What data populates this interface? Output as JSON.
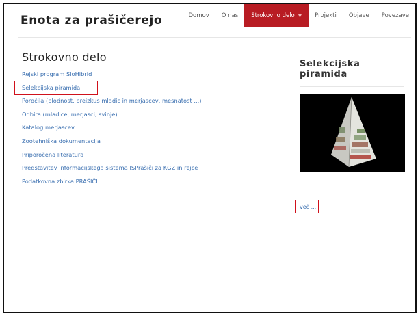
{
  "header": {
    "site_title": "Enota za prašičerejo"
  },
  "nav": {
    "items": [
      {
        "label": "Domov"
      },
      {
        "label": "O nas"
      },
      {
        "label": "Strokovno delo",
        "active": true
      },
      {
        "label": "Projekti"
      },
      {
        "label": "Objave"
      },
      {
        "label": "Povezave"
      }
    ],
    "accent_color": "#b81c23"
  },
  "main": {
    "title": "Strokovno delo",
    "links": [
      {
        "label": "Rejski program SloHibrid"
      },
      {
        "label": "Selekcijska piramida",
        "highlighted": true
      },
      {
        "label": "Poročila (plodnost, preizkus mladic in merjascev, mesnatost ...)"
      },
      {
        "label": "Odbira (mladice, merjasci, svinje)"
      },
      {
        "label": "Katalog merjascev"
      },
      {
        "label": "Zootehniška dokumentacija"
      },
      {
        "label": "Priporočena literatura"
      },
      {
        "label": "Predstavitev informacijskega sistema ISPrašiči za KGZ in rejce"
      },
      {
        "label": "Podatkovna zbirka PRAŠIČI"
      }
    ]
  },
  "sidebar": {
    "title": "Selekcijska piramida",
    "more_label": "več ..."
  },
  "colors": {
    "link": "#3a6fb0",
    "highlight_border": "#d0111b"
  }
}
